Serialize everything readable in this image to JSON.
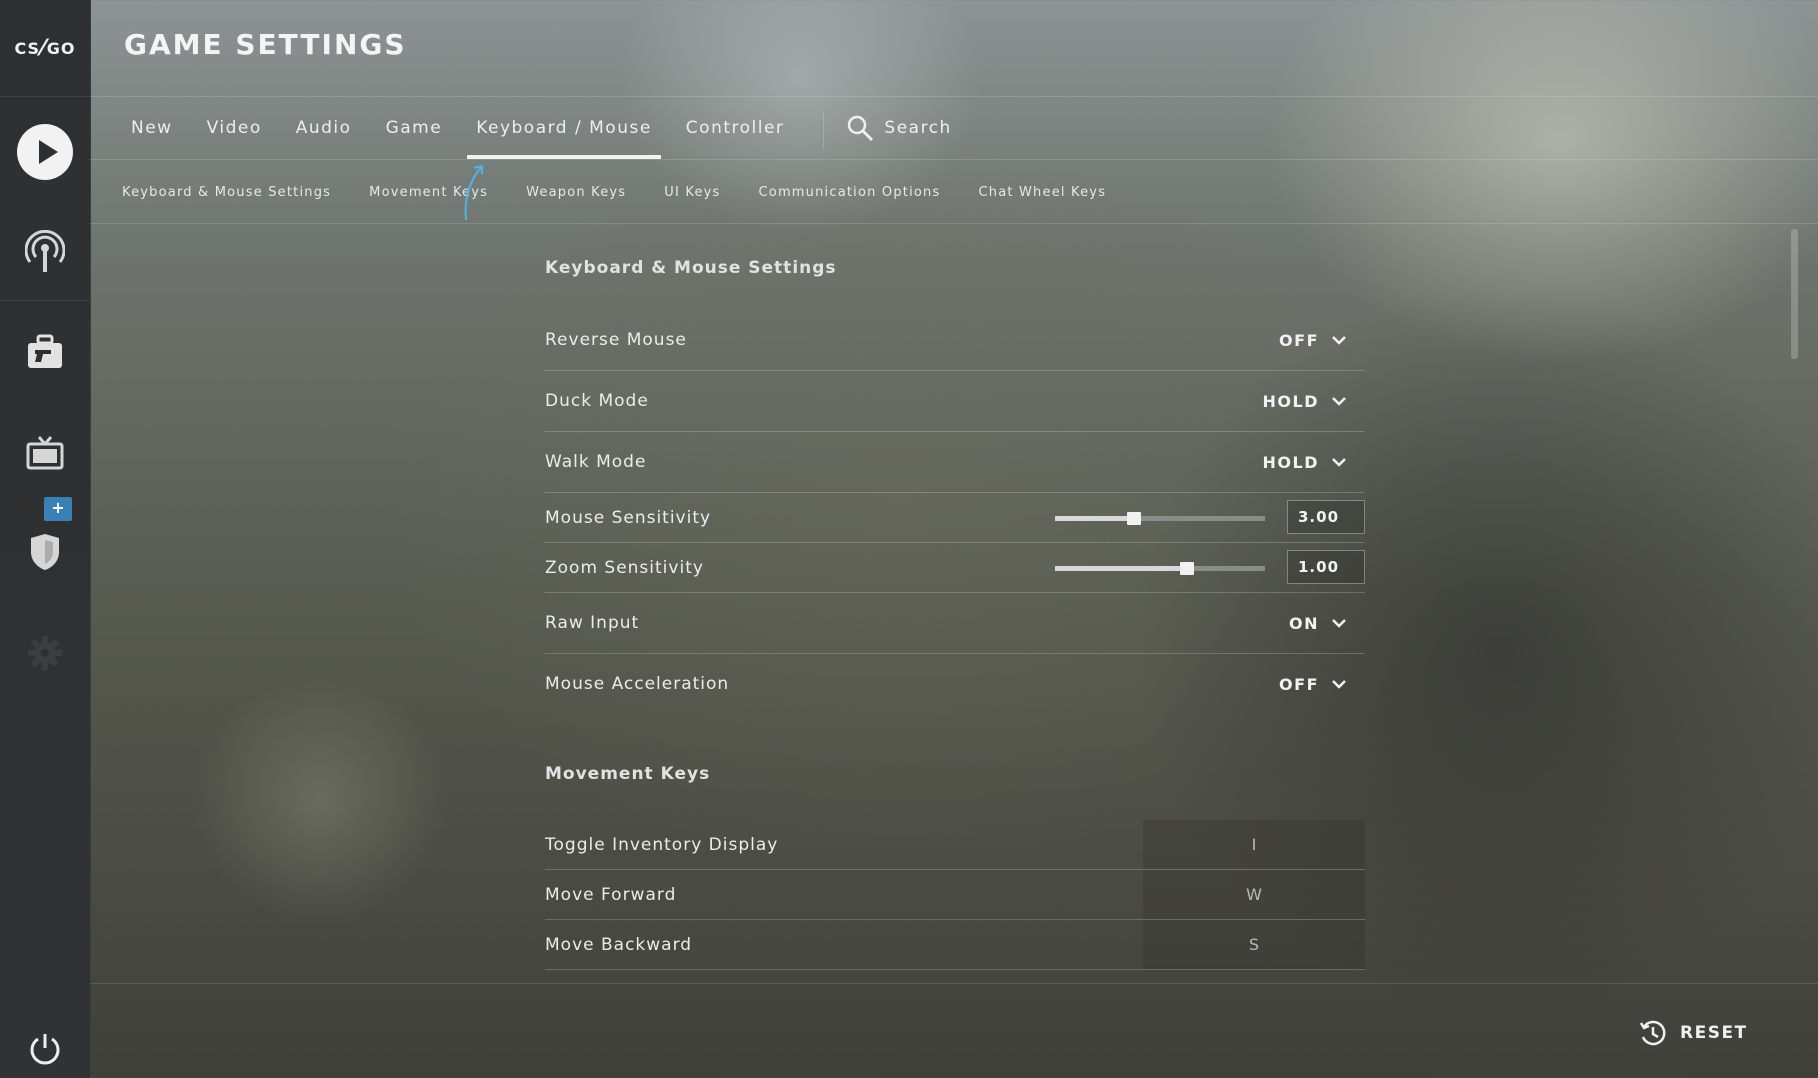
{
  "sidebar": {
    "logo_text": {
      "left": "CS",
      "slash": "⁄",
      "right": "GO"
    },
    "items": [
      {
        "name": "play",
        "icon": "play-icon"
      },
      {
        "name": "broadcast",
        "icon": "antenna-icon"
      },
      {
        "name": "inventory",
        "icon": "briefcase-icon"
      },
      {
        "name": "watch",
        "icon": "tv-icon"
      },
      {
        "name": "profile",
        "icon": "shield-icon",
        "badge": "+"
      },
      {
        "name": "settings",
        "icon": "gear-icon"
      },
      {
        "name": "power",
        "icon": "power-icon"
      }
    ]
  },
  "header": {
    "title": "GAME SETTINGS"
  },
  "tabs": {
    "items": [
      "New",
      "Video",
      "Audio",
      "Game",
      "Keyboard / Mouse",
      "Controller"
    ],
    "active": "Keyboard / Mouse",
    "search_label": "Search"
  },
  "subtabs": [
    "Keyboard & Mouse Settings",
    "Movement Keys",
    "Weapon Keys",
    "UI Keys",
    "Communication Options",
    "Chat Wheel Keys"
  ],
  "keyboard_mouse": {
    "title": "Keyboard & Mouse Settings",
    "reverse_mouse": {
      "label": "Reverse Mouse",
      "value": "OFF"
    },
    "duck_mode": {
      "label": "Duck Mode",
      "value": "HOLD"
    },
    "walk_mode": {
      "label": "Walk Mode",
      "value": "HOLD"
    },
    "mouse_sensitivity": {
      "label": "Mouse Sensitivity",
      "value": "3.00",
      "fraction": 0.375
    },
    "zoom_sensitivity": {
      "label": "Zoom Sensitivity",
      "value": "1.00",
      "fraction": 0.63
    },
    "raw_input": {
      "label": "Raw Input",
      "value": "ON"
    },
    "mouse_acceleration": {
      "label": "Mouse Acceleration",
      "value": "OFF"
    }
  },
  "movement_keys": {
    "title": "Movement Keys",
    "rows": [
      {
        "label": "Toggle Inventory Display",
        "key": "I"
      },
      {
        "label": "Move Forward",
        "key": "W"
      },
      {
        "label": "Move Backward",
        "key": "S"
      }
    ]
  },
  "footer": {
    "reset_label": "RESET"
  },
  "colors": {
    "badge": "#3a7fb6",
    "sidebar": "#2d2f31"
  }
}
